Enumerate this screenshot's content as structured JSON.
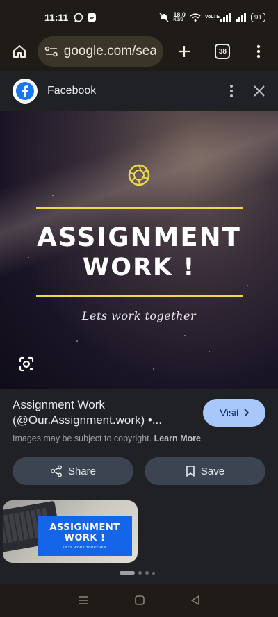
{
  "status_bar": {
    "time": "11:11",
    "left_icons": [
      "whatsapp-icon",
      "app-notification-icon"
    ],
    "network_speed": "18.0",
    "network_speed_unit": "KB/S",
    "volte": "VoLTE",
    "battery": "91",
    "right_icons": [
      "mute-icon",
      "wifi-icon",
      "signal-icon",
      "signal-icon"
    ]
  },
  "toolbar": {
    "url": "google.com/searc",
    "tab_count": "38",
    "icons": [
      "home-icon",
      "site-settings-icon",
      "new-tab-icon",
      "tab-switcher-icon",
      "overflow-menu-icon"
    ]
  },
  "source": {
    "name": "Facebook",
    "logo": "facebook-logo"
  },
  "hero": {
    "title_line1": "ASSIGNMENT",
    "title_line2": "WORK !",
    "subtitle": "Lets work together",
    "accent": "#ecd94b"
  },
  "result": {
    "title": "Assignment Work (@Our.Assignment.work) •...",
    "visit_label": "Visit",
    "copyright_text": "Images may be subject to copyright.",
    "learn_more": "Learn More"
  },
  "actions": {
    "share_label": "Share",
    "save_label": "Save"
  },
  "related": {
    "thumb_title_line1": "ASSIGNMENT",
    "thumb_title_line2": "WORK !",
    "thumb_subtitle": "LETS WORK TOGETHER"
  },
  "pagination": {
    "count": 4,
    "active": 0
  },
  "colors": {
    "visit_button": "#a8c7fa",
    "pill_button": "#3c4452",
    "sheet_bg": "#202124",
    "chrome_bg": "#1f1b16"
  }
}
